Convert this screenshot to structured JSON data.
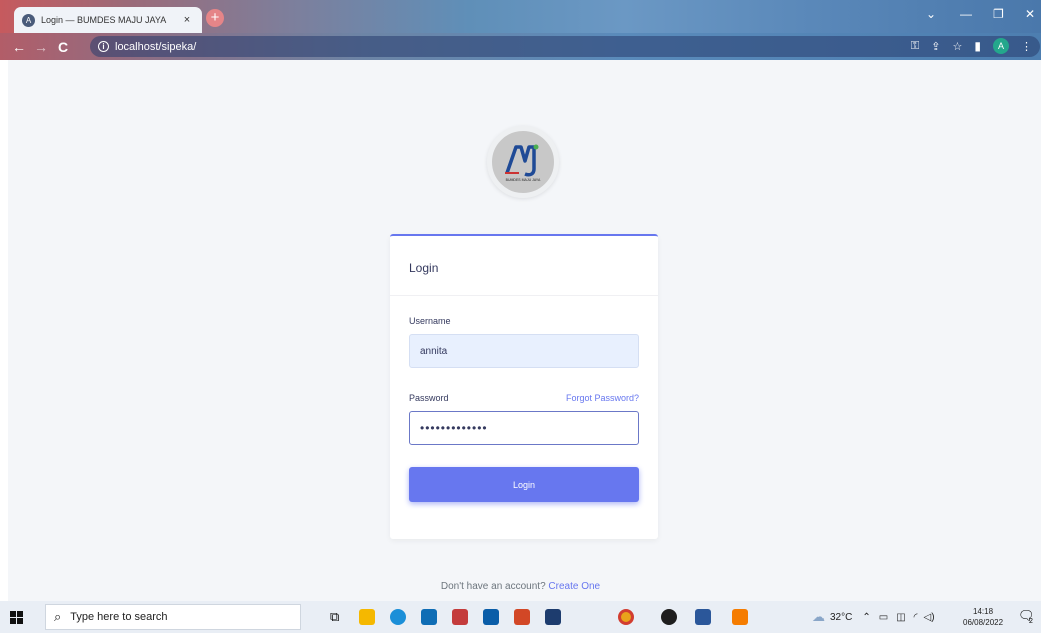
{
  "browser": {
    "tab_title": "Login — BUMDES MAJU JAYA",
    "tab_favicon": "A",
    "url": "localhost/sipeka/",
    "profile_initial": "A"
  },
  "logo": {
    "text": "BUMDES MAJU JAYA"
  },
  "card": {
    "title": "Login",
    "username_label": "Username",
    "username_value": "annita",
    "password_label": "Password",
    "forgot_label": "Forgot Password?",
    "password_mask": "•••••••••••••",
    "submit_label": "Login"
  },
  "footer": {
    "prompt": "Don't have an account?",
    "link": "Create One"
  },
  "taskbar": {
    "search_placeholder": "Type here to search",
    "weather": "32°C",
    "time": "14:18",
    "date": "06/08/2022",
    "notification_count": "2"
  }
}
